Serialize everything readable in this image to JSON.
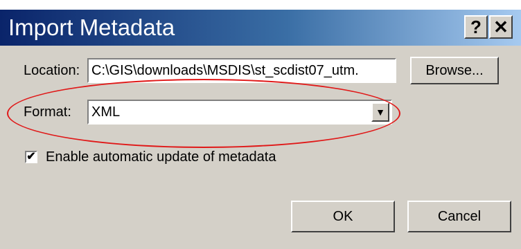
{
  "dialog": {
    "title": "Import Metadata",
    "help_glyph": "?",
    "close_glyph": "✕"
  },
  "location": {
    "label": "Location:",
    "value": "C:\\GIS\\downloads\\MSDIS\\st_scdist07_utm."
  },
  "browse_label": "Browse...",
  "format": {
    "label": "Format:",
    "value": "XML",
    "dropdown_glyph": "▼"
  },
  "auto_update": {
    "checked_glyph": "✔",
    "label": "Enable automatic update of metadata"
  },
  "ok_label": "OK",
  "cancel_label": "Cancel",
  "colors": {
    "annotation": "#e01818",
    "titlebar_start": "#0a246a",
    "titlebar_end": "#a6caf0",
    "dialog_face": "#d4d0c8"
  }
}
